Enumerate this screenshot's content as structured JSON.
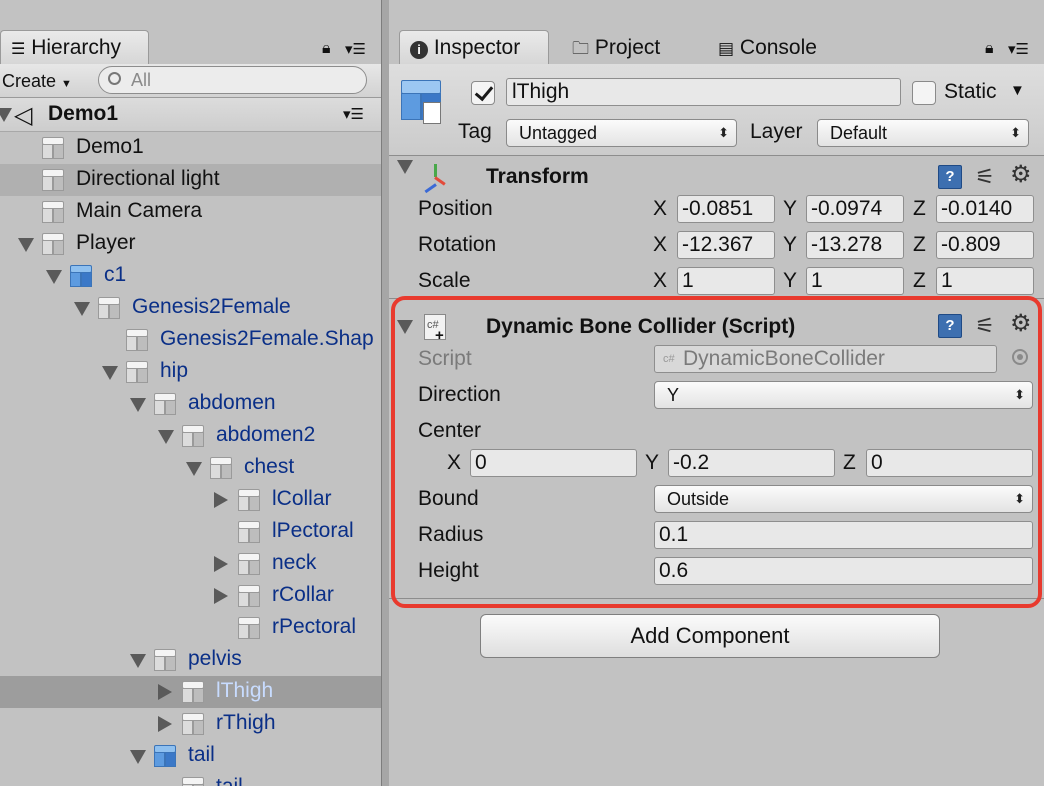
{
  "hierarchy": {
    "tab_label": "Hierarchy",
    "create_label": "Create",
    "search_placeholder": "All",
    "scene_name": "Demo1",
    "rows": [
      {
        "label": "Demo1",
        "depth": 0
      },
      {
        "label": "Directional light",
        "depth": 0
      },
      {
        "label": "Main Camera",
        "depth": 0
      },
      {
        "label": "Player",
        "depth": 0
      },
      {
        "label": "c1",
        "depth": 1
      },
      {
        "label": "Genesis2Female",
        "depth": 2
      },
      {
        "label": "Genesis2Female.Shap",
        "depth": 3
      },
      {
        "label": "hip",
        "depth": 3
      },
      {
        "label": "abdomen",
        "depth": 4
      },
      {
        "label": "abdomen2",
        "depth": 5
      },
      {
        "label": "chest",
        "depth": 6
      },
      {
        "label": "lCollar",
        "depth": 7
      },
      {
        "label": "lPectoral",
        "depth": 7
      },
      {
        "label": "neck",
        "depth": 7
      },
      {
        "label": "rCollar",
        "depth": 7
      },
      {
        "label": "rPectoral",
        "depth": 7
      },
      {
        "label": "pelvis",
        "depth": 4
      },
      {
        "label": "lThigh",
        "depth": 5
      },
      {
        "label": "rThigh",
        "depth": 5
      },
      {
        "label": "tail",
        "depth": 4
      },
      {
        "label": "tail",
        "depth": 5
      }
    ]
  },
  "tabs": {
    "inspector": "Inspector",
    "project": "Project",
    "console": "Console"
  },
  "inspector": {
    "object_name": "lThigh",
    "static_label": "Static",
    "tag_label": "Tag",
    "tag_value": "Untagged",
    "layer_label": "Layer",
    "layer_value": "Default",
    "transform": {
      "title": "Transform",
      "position_label": "Position",
      "rotation_label": "Rotation",
      "scale_label": "Scale",
      "axis_x": "X",
      "axis_y": "Y",
      "axis_z": "Z",
      "position": [
        "-0.0851",
        "-0.0974",
        "-0.0140"
      ],
      "rotation": [
        "-12.367",
        "-13.278",
        "-0.809"
      ],
      "scale": [
        "1",
        "1",
        "1"
      ]
    },
    "collider": {
      "title": "Dynamic Bone Collider (Script)",
      "script_label": "Script",
      "script_value": "DynamicBoneCollider",
      "direction_label": "Direction",
      "direction_value": "Y",
      "center_label": "Center",
      "center": [
        "0",
        "-0.2",
        "0"
      ],
      "bound_label": "Bound",
      "bound_value": "Outside",
      "radius_label": "Radius",
      "radius_value": "0.1",
      "height_label": "Height",
      "height_value": "0.6"
    },
    "add_component": "Add Component"
  },
  "colors": {
    "highlight_box": "#e83a2e",
    "hierarchy_blue_text": "#0a2f87",
    "selected_row": "#9d9d9d"
  }
}
